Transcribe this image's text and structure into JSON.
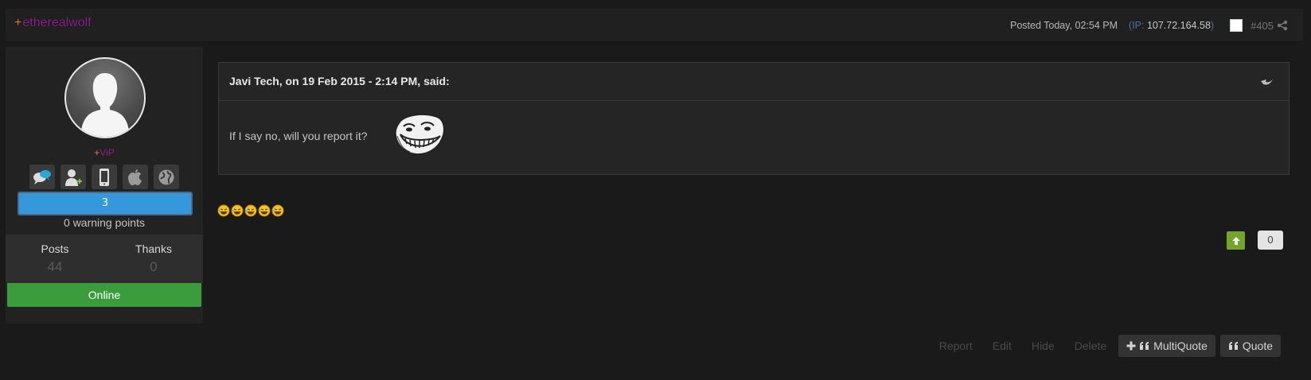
{
  "header": {
    "author_prefix": "+",
    "author_name": "etherealwolf",
    "posted": "Posted Today, 02:54 PM",
    "ip_open": "(IP: ",
    "ip_value": "107.72.164.58",
    "ip_close": ")",
    "post_number": "#405"
  },
  "sidebar": {
    "rank_prefix": "+",
    "rank": "ViP",
    "icons": [
      "messages-icon",
      "add-friend-icon",
      "mobile-icon",
      "apple-icon",
      "globe-icon"
    ],
    "warning_level": "3",
    "warning_text": "0 warning points",
    "stats": [
      {
        "label": "Posts",
        "value": "44"
      },
      {
        "label": "Thanks",
        "value": "0"
      }
    ],
    "status": "Online"
  },
  "quote": {
    "citation": "Javi Tech, on 19 Feb 2015 - 2:14 PM, said:",
    "text": "If I say no, will you report it?"
  },
  "post": {
    "emoji_count": 5
  },
  "reputation": {
    "count": "0"
  },
  "controls": {
    "report": "Report",
    "edit": "Edit",
    "hide": "Hide",
    "delete": "Delete",
    "multiquote": "MultiQuote",
    "quote": "Quote"
  },
  "colors": {
    "background": "#1a1a1a",
    "author": "#8e1f8e",
    "plus": "#e67e22",
    "warning_bar": "#3598dc",
    "online": "#3b9c3b",
    "rep_up": "#74a52a"
  }
}
